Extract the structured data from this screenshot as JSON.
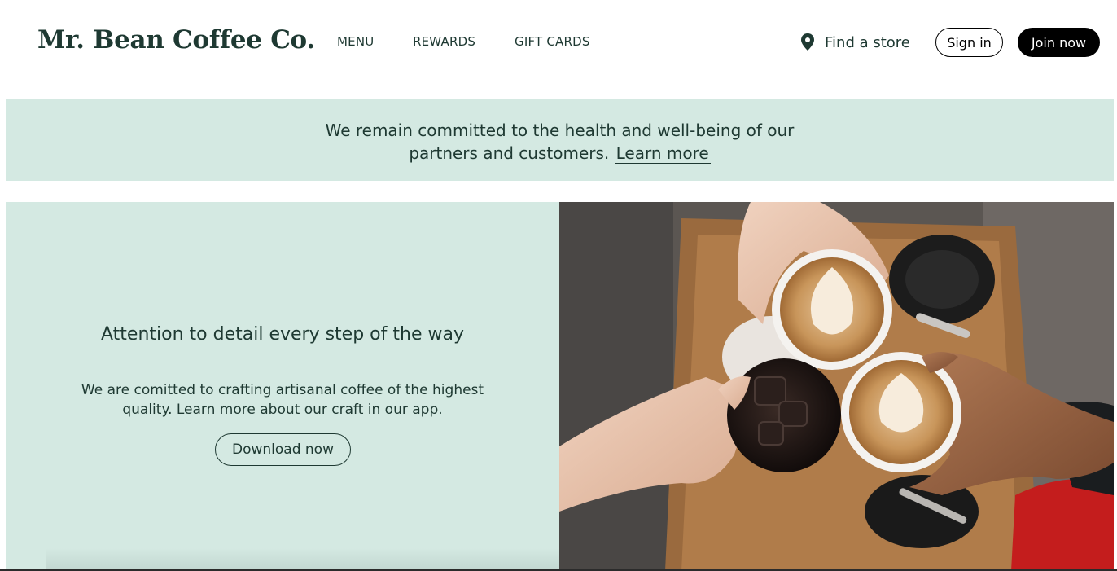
{
  "brand": {
    "name": "Mr. Bean Coffee Co."
  },
  "nav": {
    "items": [
      {
        "label": "MENU"
      },
      {
        "label": "REWARDS"
      },
      {
        "label": "GIFT CARDS"
      }
    ]
  },
  "header_actions": {
    "find_store": {
      "label": "Find a store",
      "icon": "location-pin-icon"
    },
    "sign_in": {
      "label": "Sign in"
    },
    "join_now": {
      "label": "Join now"
    }
  },
  "notice": {
    "text_line1": "We remain committed to the health and well-being of our",
    "text_line2": "partners and customers.",
    "link": "Learn more"
  },
  "promo": {
    "title": "Attention to detail every step of the way",
    "body_line1": "We are comitted to crafting artisanal coffee of the highest",
    "body_line2": "quality. Learn more about our craft in our app.",
    "button": "Download now",
    "image": "hands-toasting-coffee-cups-photo"
  },
  "colors": {
    "brand_green": "#1e3932",
    "mint_background": "#d4e9e2",
    "black": "#000000",
    "white": "#ffffff"
  }
}
